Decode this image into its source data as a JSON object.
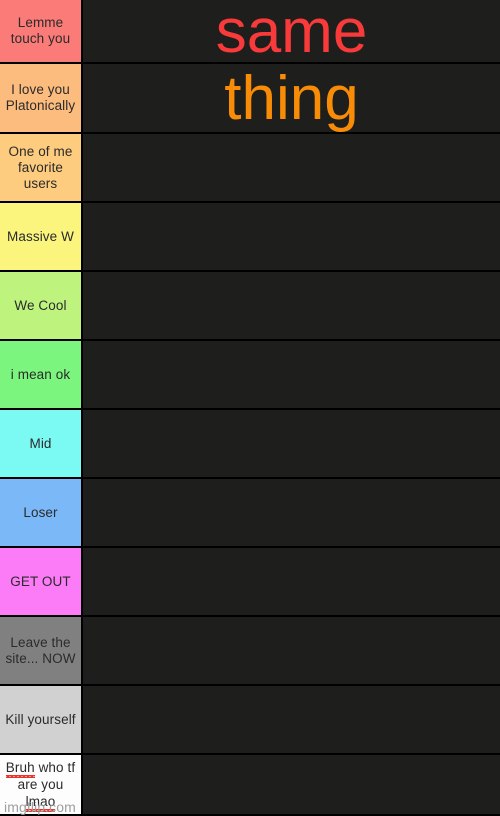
{
  "tier_list": {
    "overlay_text": {
      "line1": "same",
      "line1_color": "#f93a3a",
      "line2": "thing",
      "line2_color": "#f98c07"
    },
    "watermark": "imgflip.com",
    "rows": [
      {
        "label": "Lemme touch you",
        "color": "#fa7b77",
        "items": []
      },
      {
        "label": "I love you Platonically",
        "color": "#fcbc7e",
        "items": []
      },
      {
        "label": "One of me favorite users",
        "color": "#fdcc7e",
        "items": []
      },
      {
        "label": "Massive W",
        "color": "#fbf57e",
        "items": []
      },
      {
        "label": "We Cool",
        "color": "#bef47e",
        "items": []
      },
      {
        "label": "i mean ok",
        "color": "#7bf57e",
        "items": []
      },
      {
        "label": "Mid",
        "color": "#7bfaf4",
        "items": []
      },
      {
        "label": "Loser",
        "color": "#7bb8f7",
        "items": []
      },
      {
        "label": "GET OUT",
        "color": "#fc7bf7",
        "items": []
      },
      {
        "label": "Leave the site... NOW",
        "color": "#808080",
        "items": []
      },
      {
        "label": "Kill yourself",
        "color": "#d1d1d1",
        "items": []
      },
      {
        "label": "Bruh who tf are you lmao",
        "color": "#fdfdfd",
        "items": [],
        "misspelled": [
          "Bruh",
          "lmao"
        ]
      }
    ]
  }
}
